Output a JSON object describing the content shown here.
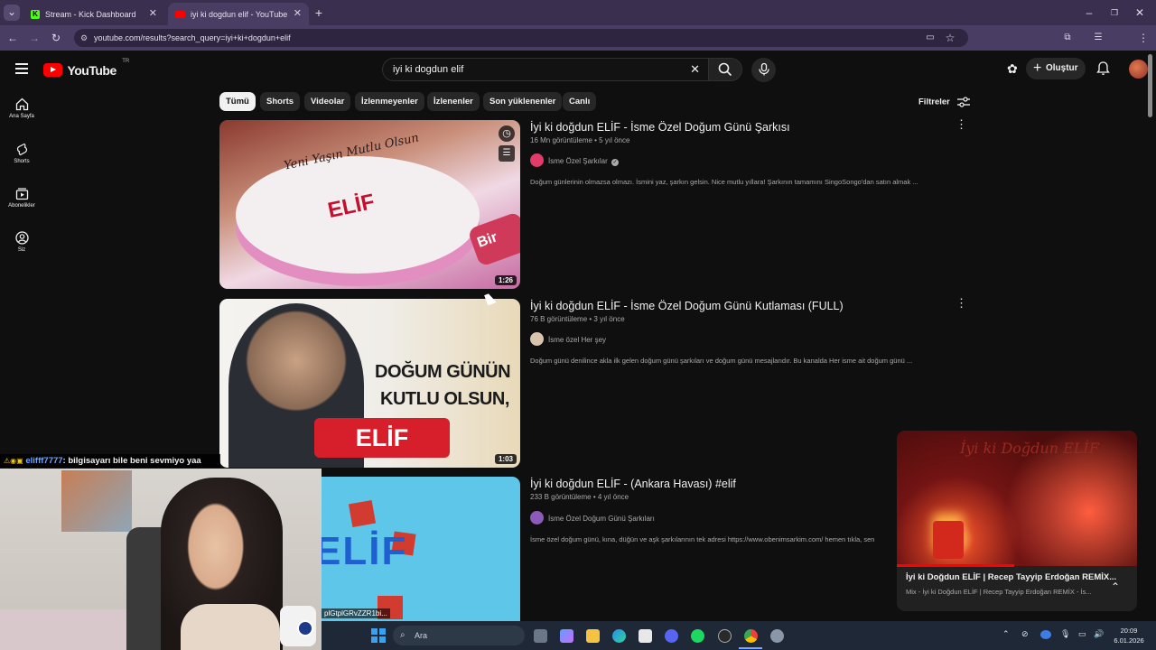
{
  "browser": {
    "tabs": [
      {
        "label": "Stream - Kick Dashboard",
        "active": false
      },
      {
        "label": "iyi ki dogdun elif - YouTube",
        "active": true
      }
    ],
    "url": "youtube.com/results?search_query=iyi+ki+dogdun+elif"
  },
  "youtube": {
    "logo": "YouTube",
    "country": "TR",
    "search_value": "iyi ki dogdun elif",
    "create_label": "Oluştur",
    "sidebar": [
      {
        "label": "Ana Sayfa",
        "icon": "home-icon"
      },
      {
        "label": "Shorts",
        "icon": "shorts-icon"
      },
      {
        "label": "Abonelikler",
        "icon": "subscriptions-icon"
      },
      {
        "label": "Siz",
        "icon": "user-icon"
      }
    ],
    "chips": [
      "Tümü",
      "Shorts",
      "Videolar",
      "İzlenmeyenler",
      "İzlenenler",
      "Son yüklenenler",
      "Canlı"
    ],
    "filters_label": "Filtreler",
    "results": [
      {
        "title": "İyi ki doğdun ELİF - İsme Özel Doğum Günü Şarkısı",
        "meta": "16 Mn görüntüleme • 5 yıl önce",
        "channel": "İsme Özel Şarkılar",
        "verified": true,
        "description": "Doğum günlerinin olmazsa olmazı. İsmini yaz, şarkın gelsin. Nice mutlu yıllara! Şarkının tamamını SingoSongo'dan satın almak ...",
        "duration": "1:26",
        "thumb_text_1": "Yeni Yaşın Mutlu Olsun",
        "thumb_text_2": "ELİF",
        "thumb_text_3": "Bir"
      },
      {
        "title": "İyi ki doğdun ELİF - İsme Özel Doğum Günü Kutlaması (FULL)",
        "meta": "76 B görüntüleme • 3 yıl önce",
        "channel": "İsme özel Her şey",
        "verified": false,
        "description": "Doğum günü denilince akla ilk gelen doğum günü şarkıları ve doğum günü mesajlarıdır. Bu kanalda Her isme ait doğum günü ...",
        "duration": "1:03",
        "thumb_text_1": "DOĞUM GÜNÜN",
        "thumb_text_2": "KUTLU OLSUN,",
        "thumb_text_3": "ELİF"
      },
      {
        "title": "İyi ki doğdun ELİF - (Ankara Havası) #elif",
        "meta": "233 B görüntüleme • 4 yıl önce",
        "channel": "İsme Özel Doğum Günü Şarkıları",
        "verified": false,
        "description": "İsme özel doğum günü, kına, düğün ve aşk şarkılarının tek adresi https://www.obenimsarkim.com/ hemen tıkla, sen",
        "duration": "",
        "thumb_text_1": "ELİF",
        "thumb_text_2": "",
        "thumb_text_3": ""
      }
    ],
    "miniplayer": {
      "overlay_text": "İyi ki Doğdun ELİF",
      "title": "İyi ki Doğdun ELİF | Recep Tayyip Erdoğan REMİX...",
      "subtitle": "Mix - İyi ki Doğdun ELİF | Recep Tayyip Erdoğan REMİX - İs..."
    }
  },
  "stream_overlay": {
    "chat_user": "elifff7777",
    "chat_message": ": bilgisayarı bile beni sevmiyo yaa",
    "webcam_caption": "plGtplGRvZZR1bi..."
  },
  "taskbar": {
    "search_placeholder": "Ara",
    "time": "20:09",
    "date": "6.01.2026"
  }
}
